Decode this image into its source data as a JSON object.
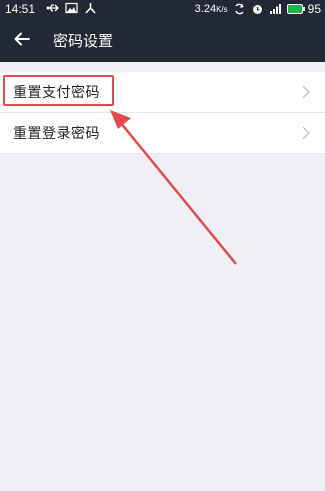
{
  "status_bar": {
    "time": "14:51",
    "net_speed": "3.24",
    "net_unit": "K/s",
    "battery": "95",
    "icons": [
      "usb-icon",
      "image-icon",
      "share-icon",
      "sync-icon",
      "alarm-icon",
      "signal-icon",
      "battery-icon"
    ],
    "battery_color": "#21b24b"
  },
  "header": {
    "title": "密码设置",
    "background": "#222836"
  },
  "menu": {
    "items": [
      {
        "label": "重置支付密码"
      },
      {
        "label": "重置登录密码"
      }
    ]
  },
  "annotation": {
    "color": "#e24b4b"
  }
}
